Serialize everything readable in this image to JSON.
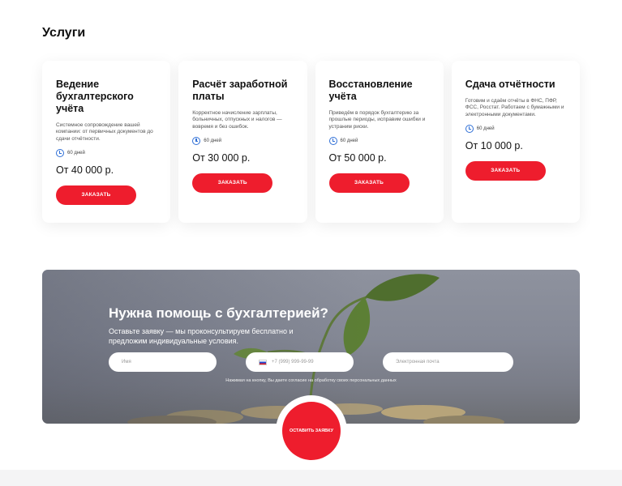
{
  "services": {
    "title": "Услуги",
    "cards": [
      {
        "title": "Ведение бухгалтерского учёта",
        "description": "Системное сопровождение вашей компании: от первичных документов до сдачи отчётности.",
        "duration": "60 дней",
        "price": "От 40 000 р.",
        "button": "ЗАКАЗАТЬ"
      },
      {
        "title": "Расчёт заработной платы",
        "description": "Корректное начисление зарплаты, больничных, отпускных и налогов — вовремя и без ошибок.",
        "duration": "60 дней",
        "price": "От 30 000 р.",
        "button": "ЗАКАЗАТЬ"
      },
      {
        "title": "Восстановление учёта",
        "description": "Приведём в порядок бухгалтерию за прошлые периоды, исправим ошибки и устраним риски.",
        "duration": "60 дней",
        "price": "От 50 000 р.",
        "button": "ЗАКАЗАТЬ"
      },
      {
        "title": "Сдача отчётности",
        "description": "Готовим и сдаём отчёты в ФНС, ПФР, ФСС, Росстат. Работаем с бумажными и электронными документами.",
        "duration": "60 дней",
        "price": "От 10 000 р.",
        "button": "ЗАКАЗАТЬ"
      }
    ]
  },
  "cta": {
    "title": "Нужна помощь с бухгалтерией?",
    "subtitle": "Оставьте заявку — мы проконсультируем бесплатно и предложим индивидуальные условия.",
    "name_placeholder": "Имя",
    "phone_placeholder": "+7 (999) 999-99-99",
    "email_placeholder": "Электронная почта",
    "consent": "Нажимая на кнопку, Вы даете согласие на обработку своих персональных данных",
    "submit": "ОСТАВИТЬ ЗАЯВКУ"
  },
  "colors": {
    "accent": "#ee1d2d",
    "icon": "#2f6fd6"
  }
}
